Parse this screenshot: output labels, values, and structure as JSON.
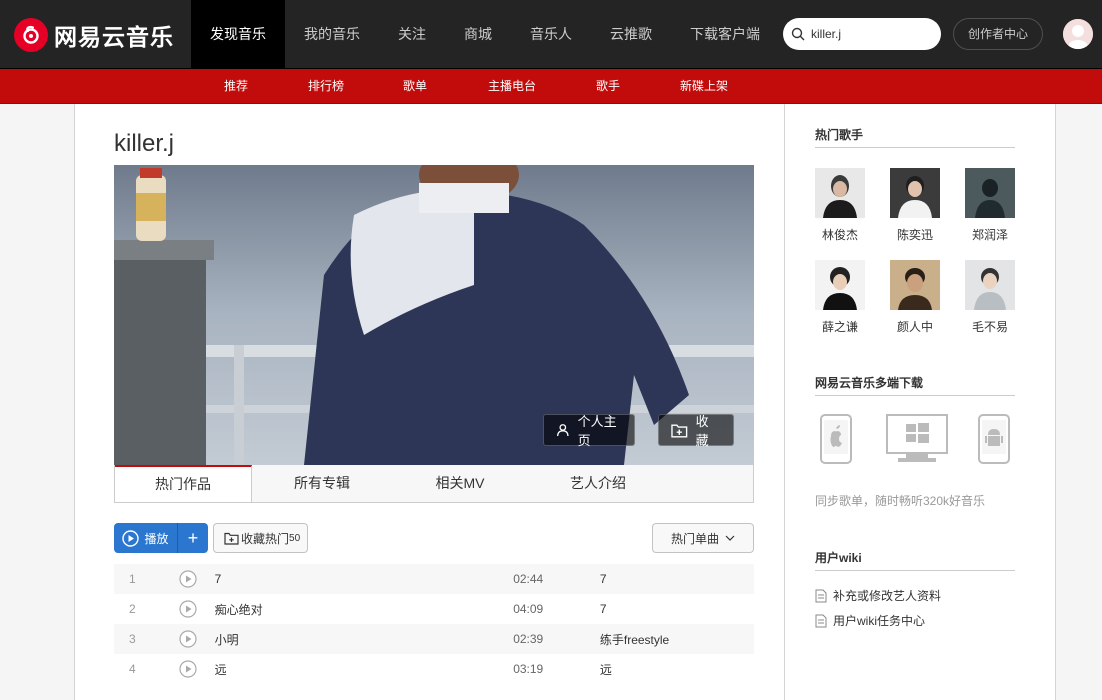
{
  "brand": {
    "name": "网易云音乐",
    "color": "#c20c0c"
  },
  "nav": {
    "items": [
      "发现音乐",
      "我的音乐",
      "关注",
      "商城",
      "音乐人",
      "云推歌",
      "下载客户端"
    ],
    "active_index": 0
  },
  "search": {
    "value": "killer.j"
  },
  "creator_button": "创作者中心",
  "subnav": {
    "items": [
      "推荐",
      "排行榜",
      "歌单",
      "主播电台",
      "歌手",
      "新碟上架"
    ]
  },
  "artist": {
    "name": "killer.j",
    "profile_button": "个人主页",
    "collect_button": "收藏"
  },
  "tabs": [
    "热门作品",
    "所有专辑",
    "相关MV",
    "艺人介绍"
  ],
  "actions": {
    "play_label": "播放",
    "add_label": "+",
    "collect_label": "收藏热门",
    "collect_count": "50",
    "sort_label": "热门单曲"
  },
  "songs": [
    {
      "idx": "1",
      "title": "7",
      "duration": "02:44",
      "album": "7"
    },
    {
      "idx": "2",
      "title": "痴心绝对",
      "duration": "04:09",
      "album": "7"
    },
    {
      "idx": "3",
      "title": "小明",
      "duration": "02:39",
      "album": "练手freestyle"
    },
    {
      "idx": "4",
      "title": "远",
      "duration": "03:19",
      "album": "远"
    }
  ],
  "sidebar": {
    "hot_singers_title": "热门歌手",
    "singers": [
      "林俊杰",
      "陈奕迅",
      "郑润泽",
      "薛之谦",
      "颜人中",
      "毛不易"
    ],
    "download_title": "网易云音乐多端下载",
    "download_caption": "同步歌单，随时畅听320k好音乐",
    "wiki_title": "用户wiki",
    "wiki_links": [
      "补充或修改艺人资料",
      "用户wiki任务中心"
    ]
  }
}
